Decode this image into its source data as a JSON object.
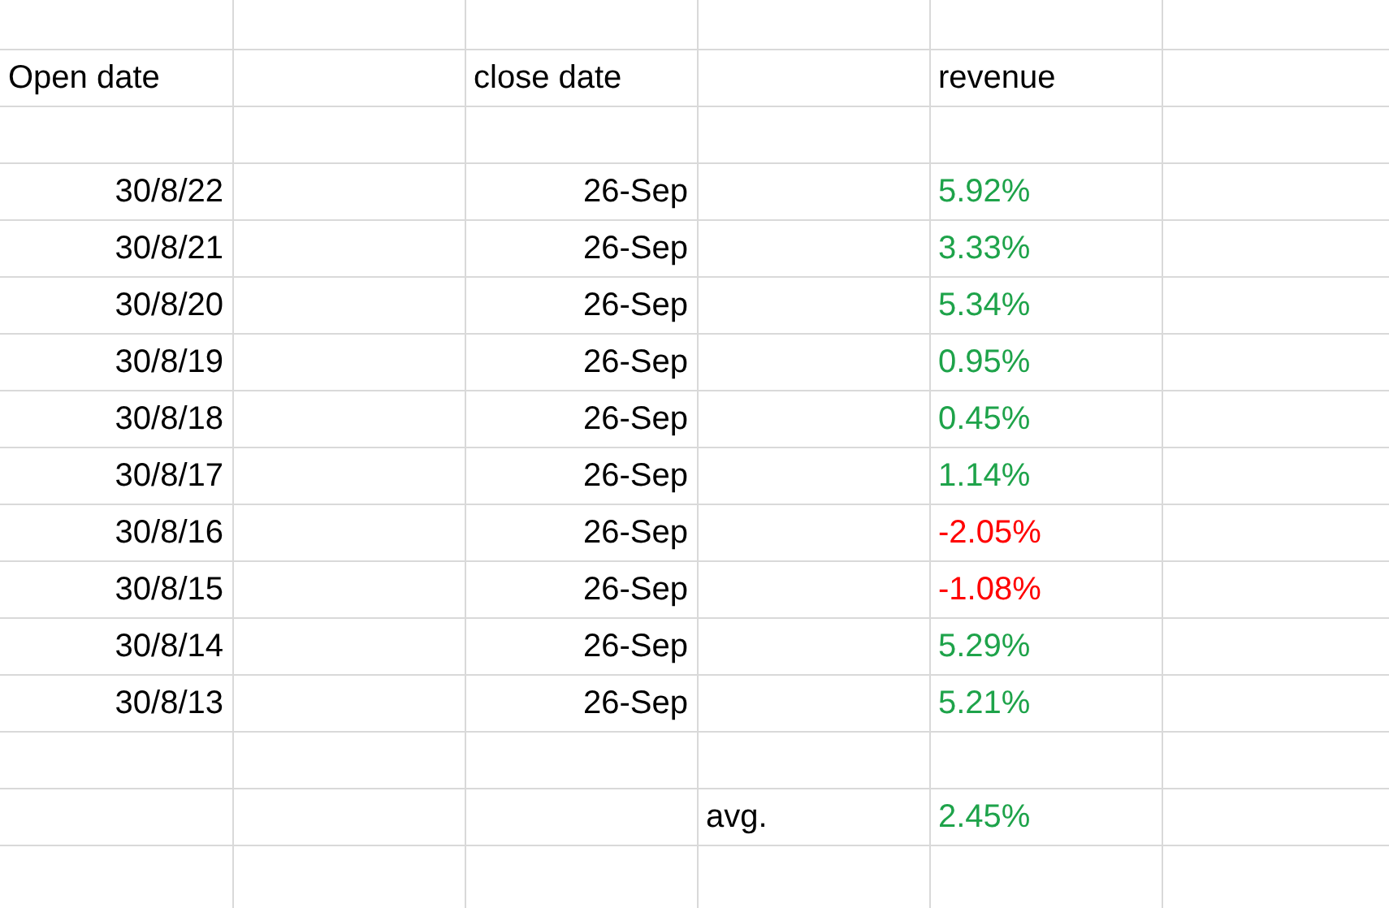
{
  "header": {
    "open_date": "Open date",
    "close_date": "close date",
    "revenue": "revenue"
  },
  "rows": [
    {
      "open_date": "30/8/22",
      "close_date": "26-Sep",
      "revenue": "5.92%",
      "color": "#1ea34a"
    },
    {
      "open_date": "30/8/21",
      "close_date": "26-Sep",
      "revenue": "3.33%",
      "color": "#1ea34a"
    },
    {
      "open_date": "30/8/20",
      "close_date": "26-Sep",
      "revenue": "5.34%",
      "color": "#1ea34a"
    },
    {
      "open_date": "30/8/19",
      "close_date": "26-Sep",
      "revenue": "0.95%",
      "color": "#1ea34a"
    },
    {
      "open_date": "30/8/18",
      "close_date": "26-Sep",
      "revenue": "0.45%",
      "color": "#1ea34a"
    },
    {
      "open_date": "30/8/17",
      "close_date": "26-Sep",
      "revenue": "1.14%",
      "color": "#1ea34a"
    },
    {
      "open_date": "30/8/16",
      "close_date": "26-Sep",
      "revenue": "-2.05%",
      "color": "#ff0000"
    },
    {
      "open_date": "30/8/15",
      "close_date": "26-Sep",
      "revenue": "-1.08%",
      "color": "#ff0000"
    },
    {
      "open_date": "30/8/14",
      "close_date": "26-Sep",
      "revenue": "5.29%",
      "color": "#1ea34a"
    },
    {
      "open_date": "30/8/13",
      "close_date": "26-Sep",
      "revenue": "5.21%",
      "color": "#1ea34a"
    }
  ],
  "average": {
    "label": "avg.",
    "value": "2.45%",
    "color": "#1ea34a"
  }
}
